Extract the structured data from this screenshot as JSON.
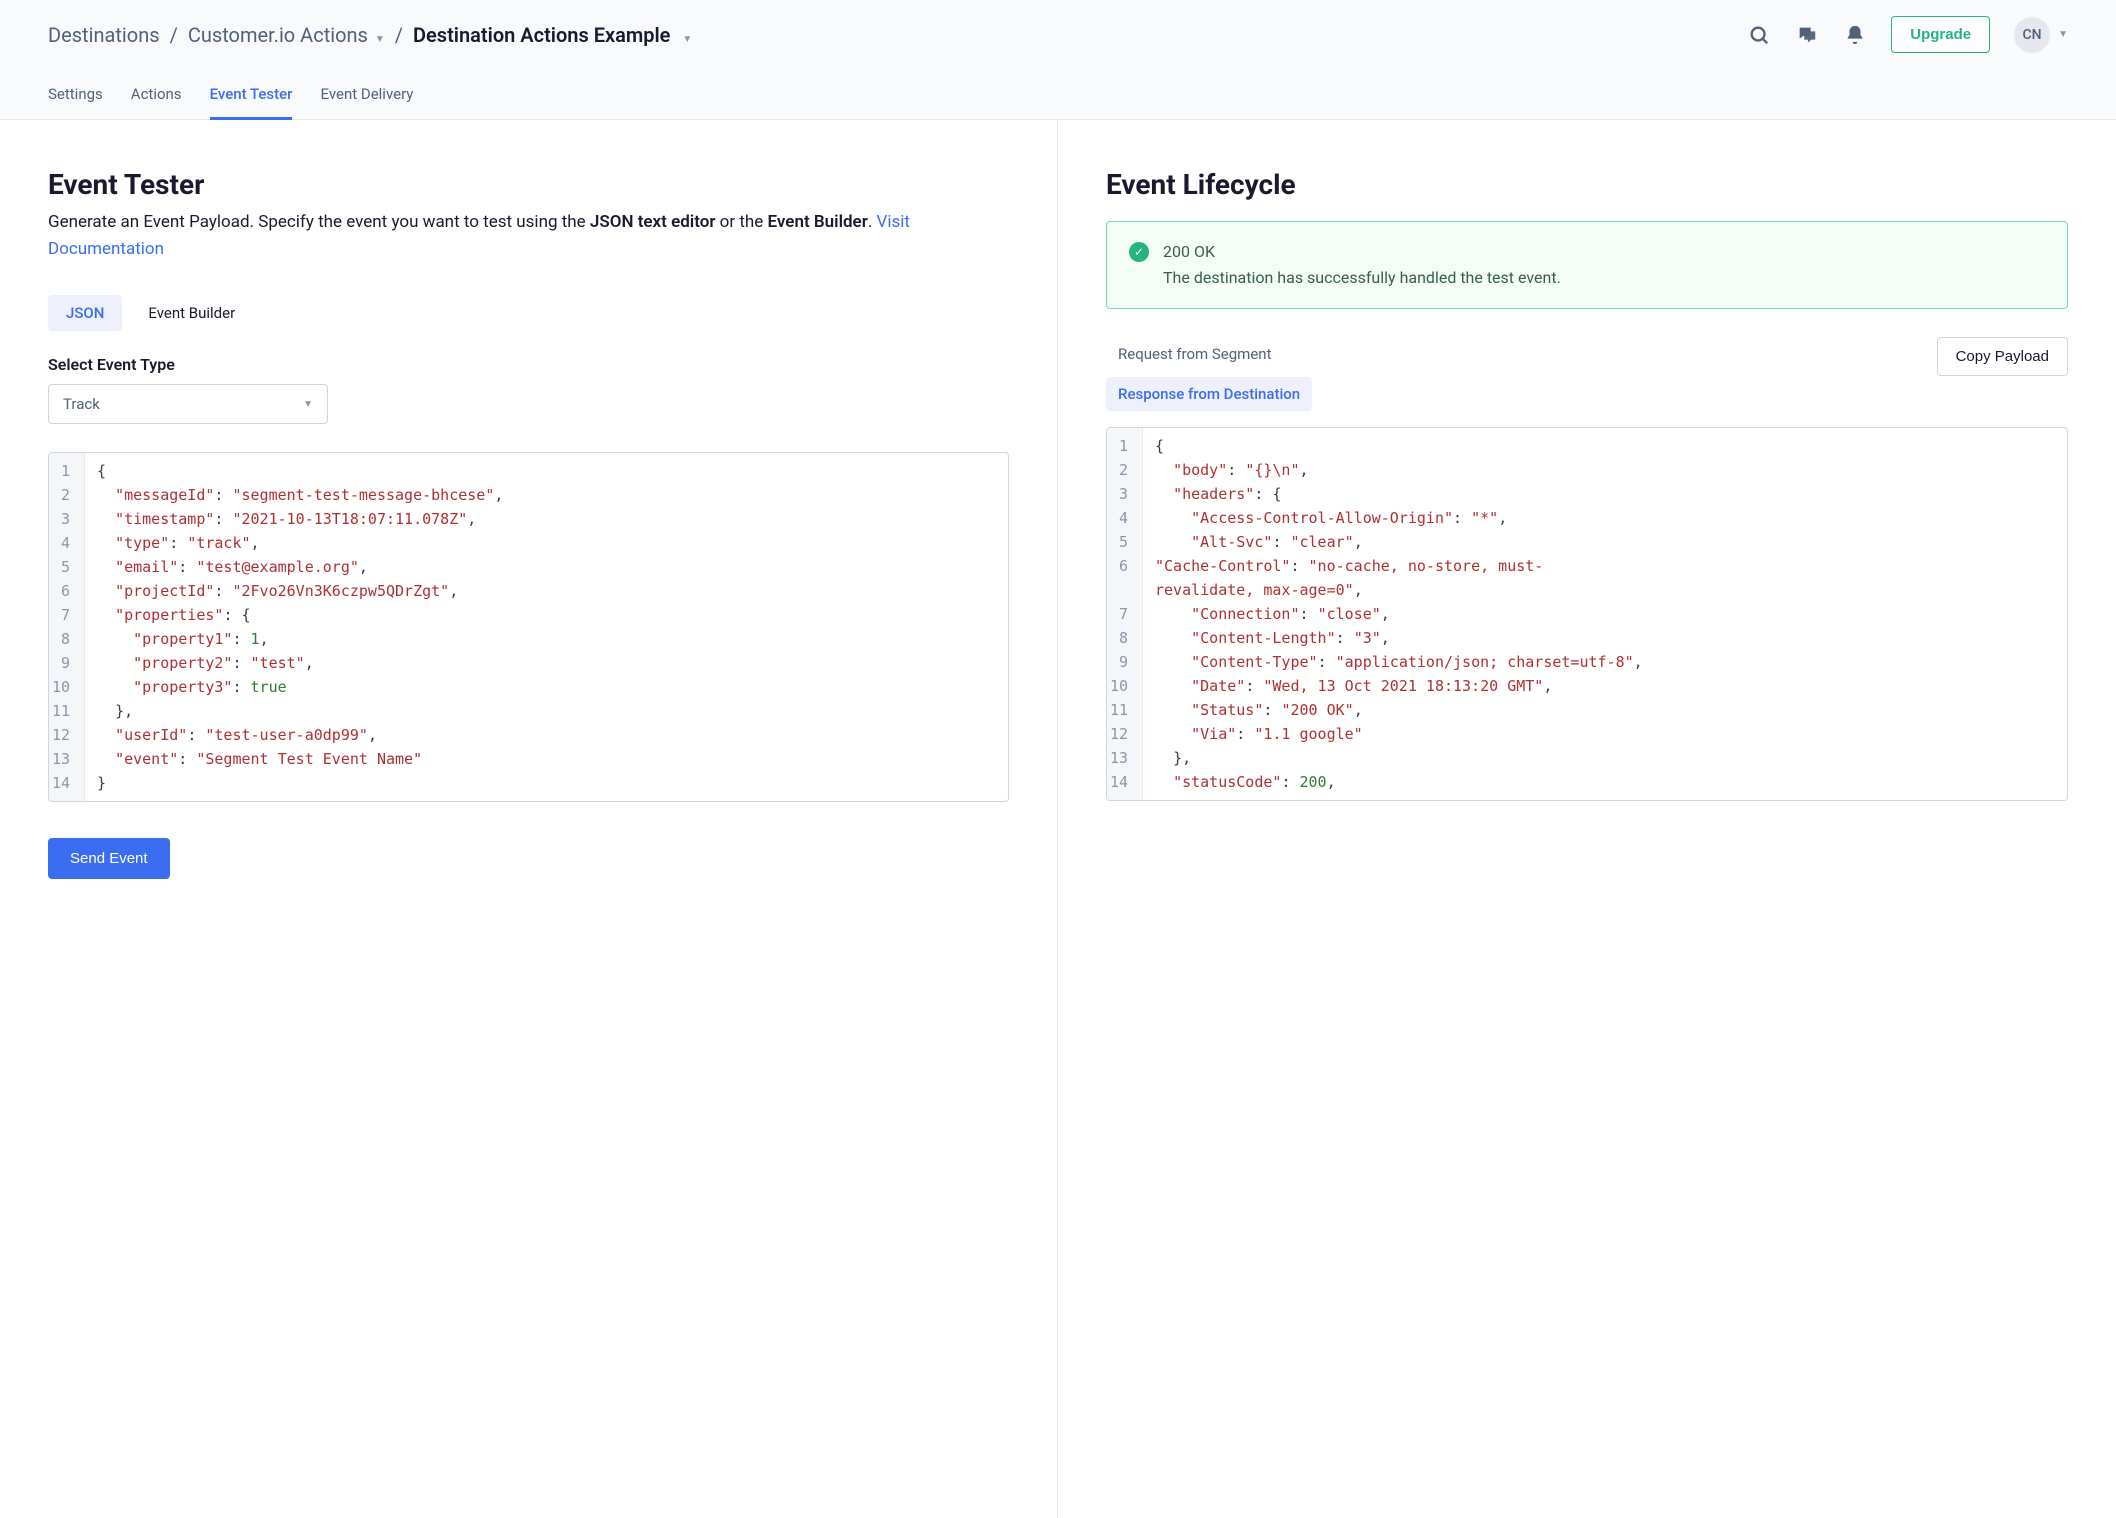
{
  "header": {
    "breadcrumb": {
      "root": "Destinations",
      "parent": "Customer.io Actions",
      "current": "Destination Actions Example"
    },
    "upgrade_label": "Upgrade",
    "avatar_initials": "CN"
  },
  "tabs": [
    {
      "label": "Settings"
    },
    {
      "label": "Actions"
    },
    {
      "label": "Event Tester",
      "active": true
    },
    {
      "label": "Event Delivery"
    }
  ],
  "left": {
    "title": "Event Tester",
    "subtitle_pre": "Generate an Event Payload. Specify the event you want to test using the ",
    "subtitle_bold1": "JSON text editor",
    "subtitle_mid": " or the ",
    "subtitle_bold2": "Event Builder",
    "subtitle_post": ". ",
    "doc_link": "Visit Documentation",
    "mode_tabs": {
      "json": "JSON",
      "builder": "Event Builder"
    },
    "select_label": "Select Event Type",
    "select_value": "Track",
    "send_button": "Send Event",
    "payload": {
      "messageId": "segment-test-message-bhcese",
      "timestamp": "2021-10-13T18:07:11.078Z",
      "type": "track",
      "email": "test@example.org",
      "projectId": "2Fvo26Vn3K6czpw5QDrZgt",
      "properties": {
        "property1": 1,
        "property2": "test",
        "property3": true
      },
      "userId": "test-user-a0dp99",
      "event": "Segment Test Event Name"
    }
  },
  "right": {
    "title": "Event Lifecycle",
    "alert": {
      "status": "200 OK",
      "message": "The destination has successfully handled the test event."
    },
    "req_tab": "Request from Segment",
    "resp_tab": "Response from Destination",
    "copy_label": "Copy Payload",
    "response": {
      "body": "{}\\n",
      "headers": {
        "Access-Control-Allow-Origin": "*",
        "Alt-Svc": "clear",
        "Cache-Control": "no-cache, no-store, must-revalidate, max-age=0",
        "Connection": "close",
        "Content-Length": "3",
        "Content-Type": "application/json; charset=utf-8",
        "Date": "Wed, 13 Oct 2021 18:13:20 GMT",
        "Status": "200 OK",
        "Via": "1.1 google"
      },
      "statusCode": 200
    }
  }
}
